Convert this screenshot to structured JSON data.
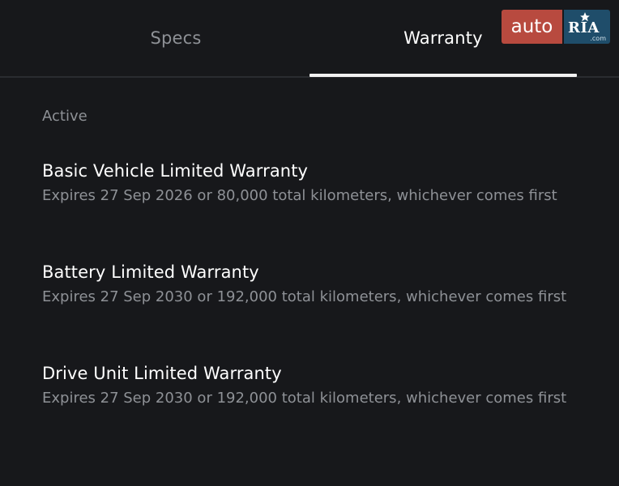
{
  "tabs": [
    {
      "label": "Specs",
      "active": false
    },
    {
      "label": "Warranty",
      "active": true
    }
  ],
  "logo": {
    "left_text": "auto",
    "right_text": "RIA",
    "right_suffix": ".com",
    "left_color": "#b84a3f",
    "right_color": "#1f4d6a"
  },
  "section_label": "Active",
  "warranties": [
    {
      "title": "Basic Vehicle Limited Warranty",
      "description": "Expires 27 Sep 2026 or 80,000 total kilometers, whichever comes first"
    },
    {
      "title": "Battery Limited Warranty",
      "description": "Expires 27 Sep 2030 or 192,000 total kilometers, whichever comes first"
    },
    {
      "title": "Drive Unit Limited Warranty",
      "description": "Expires 27 Sep 2030 or 192,000 total kilometers, whichever comes first"
    }
  ],
  "colors": {
    "background": "#17181b",
    "primary_text": "#ffffff",
    "secondary_text": "#8e9196",
    "tab_indicator": "#f2f2f2"
  }
}
